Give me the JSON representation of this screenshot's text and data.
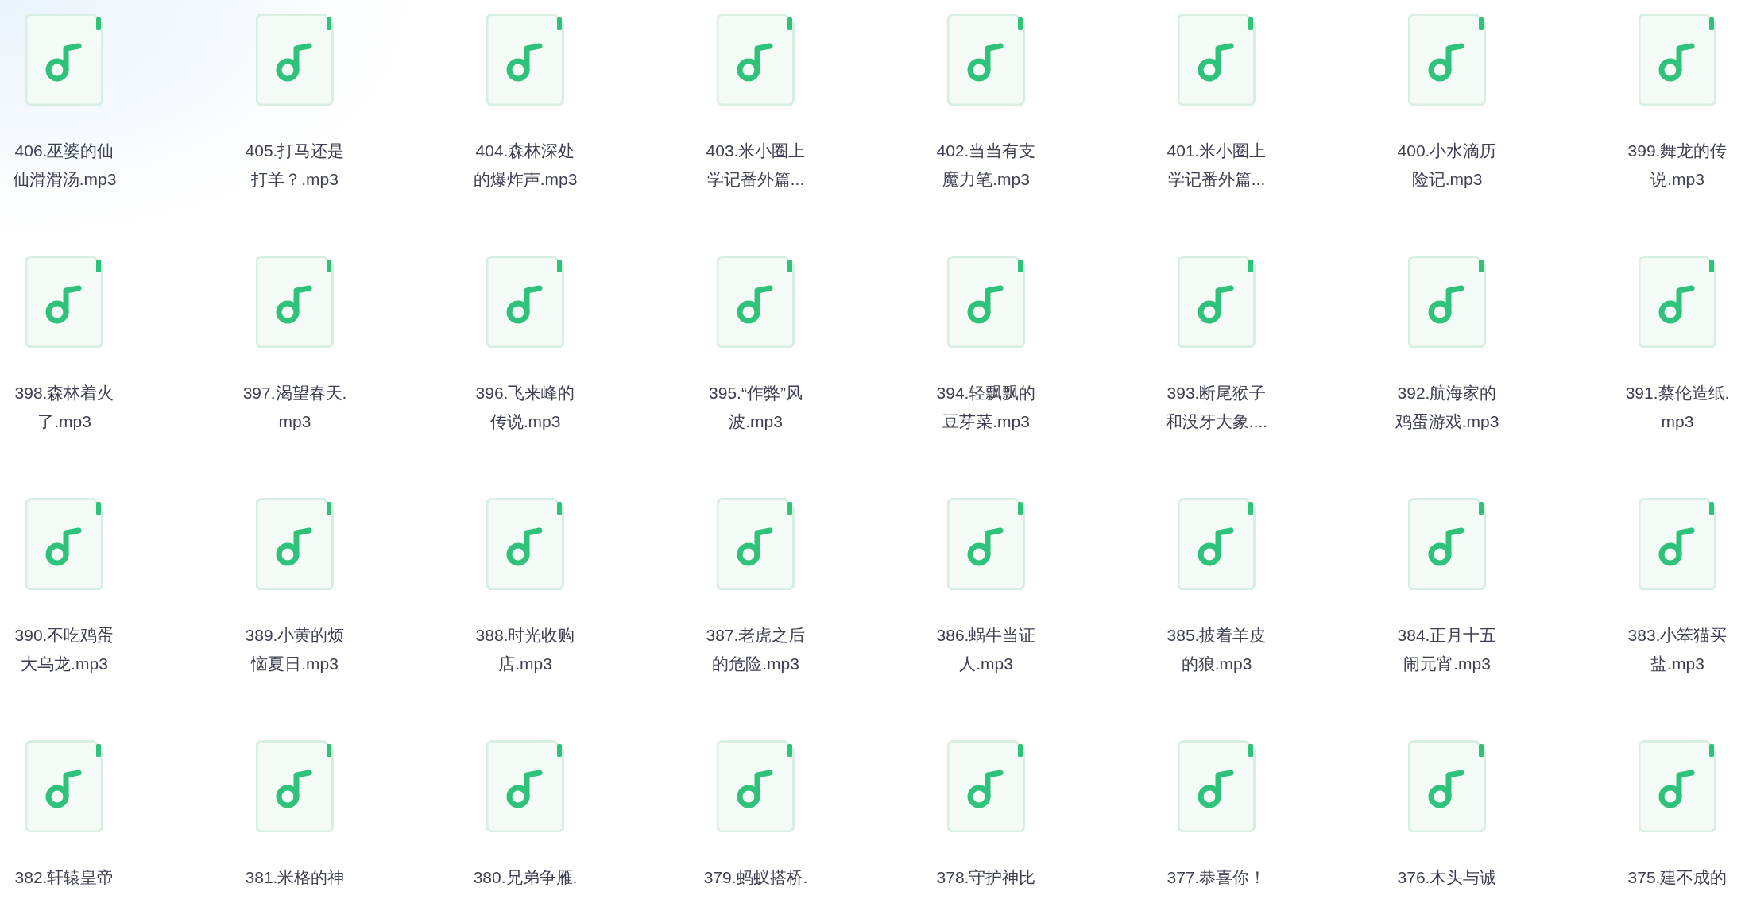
{
  "files": [
    {
      "name": "406.巫婆的仙仙滑滑汤.mp3"
    },
    {
      "name": "405.打马还是打羊？.mp3"
    },
    {
      "name": "404.森林深处的爆炸声.mp3"
    },
    {
      "name": "403.米小圈上学记番外篇..."
    },
    {
      "name": "402.当当有支魔力笔.mp3"
    },
    {
      "name": "401.米小圈上学记番外篇..."
    },
    {
      "name": "400.小水滴历险记.mp3"
    },
    {
      "name": "399.舞龙的传说.mp3"
    },
    {
      "name": "398.森林着火了.mp3"
    },
    {
      "name": "397.渴望春天.mp3"
    },
    {
      "name": "396.飞来峰的传说.mp3"
    },
    {
      "name": "395.“作弊”风波.mp3"
    },
    {
      "name": "394.轻飘飘的豆芽菜.mp3"
    },
    {
      "name": "393.断尾猴子和没牙大象...."
    },
    {
      "name": "392.航海家的鸡蛋游戏.mp3"
    },
    {
      "name": "391.蔡伦造纸.mp3"
    },
    {
      "name": "390.不吃鸡蛋大乌龙.mp3"
    },
    {
      "name": "389.小黄的烦恼夏日.mp3"
    },
    {
      "name": "388.时光收购店.mp3"
    },
    {
      "name": "387.老虎之后的危险.mp3"
    },
    {
      "name": "386.蜗牛当证人.mp3"
    },
    {
      "name": "385.披着羊皮的狼.mp3"
    },
    {
      "name": "384.正月十五闹元宵.mp3"
    },
    {
      "name": "383.小笨猫买盐.mp3"
    },
    {
      "name": "382.轩辕皇帝"
    },
    {
      "name": "381.米格的神"
    },
    {
      "name": "380.兄弟争雁."
    },
    {
      "name": "379.蚂蚁搭桥."
    },
    {
      "name": "378.守护神比"
    },
    {
      "name": "377.恭喜你！"
    },
    {
      "name": "376.木头与诚"
    },
    {
      "name": "375.建不成的"
    }
  ]
}
